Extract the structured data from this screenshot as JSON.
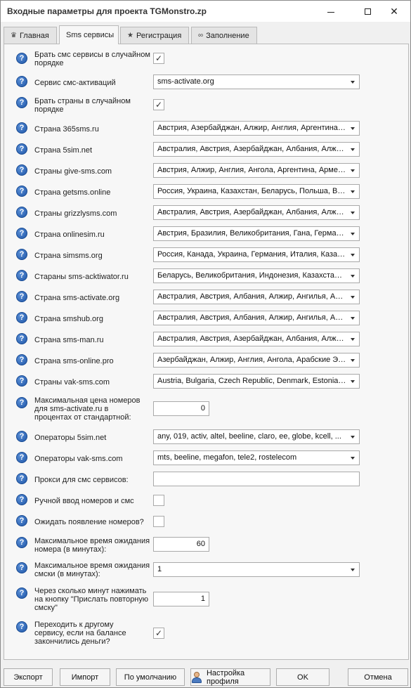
{
  "window": {
    "title": "Входные параметры для проекта TGMonstro.zp",
    "minimize_icon": "minimize-icon",
    "maximize_icon": "maximize-icon",
    "close_icon": "close-icon",
    "close_glyph": "✕"
  },
  "tabs": [
    {
      "label": "Главная",
      "icon": "home-icon",
      "glyph": "♛"
    },
    {
      "label": "Sms сервисы",
      "icon": "",
      "glyph": ""
    },
    {
      "label": "Регистрация",
      "icon": "star-icon",
      "glyph": "★"
    },
    {
      "label": "Заполнение",
      "icon": "infinity-icon",
      "glyph": "∞"
    }
  ],
  "active_tab": "Sms сервисы",
  "help_glyph": "?",
  "check_glyph": "✓",
  "fields": {
    "random_sms": {
      "label": "Брать смс сервисы в случайном порядке",
      "checked": true
    },
    "sms_service": {
      "label": "Сервис смс-активаций",
      "value": "sms-activate.org"
    },
    "random_countries": {
      "label": "Брать страны в случайном порядке",
      "checked": true
    },
    "c365": {
      "label": "Страна 365sms.ru",
      "value": "Австрия, Азербайджан, Алжир, Англия, Аргентина, ..."
    },
    "c5sim": {
      "label": "Страна 5sim.net",
      "value": "Австралия, Австрия, Азербайджан, Албания, Алжир, ..."
    },
    "cgive": {
      "label": "Страны give-sms.com",
      "value": "Австрия, Алжир, Англия, Ангола, Аргентина, Армения, ..."
    },
    "cgetsms": {
      "label": "Страна getsms.online",
      "value": "Россия, Украина, Казахстан, Беларусь, Польша, Великобритания, ..."
    },
    "cgrizzly": {
      "label": "Страны grizzlysms.com",
      "value": "Австралия, Австрия, Азербайджан, Албания, Алжир, ..."
    },
    "conlinesim": {
      "label": "Страна onlinesim.ru",
      "value": "Австрия, Бразилия, Великобритания, Гана, Германия, ..."
    },
    "csimsms": {
      "label": "Страна simsms.org",
      "value": "Россия, Канада, Украина, Германия, Италия, Казахстан, ..."
    },
    "cakt": {
      "label": "Стараны sms-acktiwator.ru",
      "value": "Беларусь, Великобритания, Индонезия, Казахстан, ..."
    },
    "cactivate": {
      "label": "Страна sms-activate.org",
      "value": "Австралия, Австрия, Албания, Алжир, Ангилья, Ангола, ..."
    },
    "csmshub": {
      "label": "Страна smshub.org",
      "value": "Австралия, Австрия, Албания, Алжир, Ангилья, Ангола, ..."
    },
    "csmsman": {
      "label": "Страна sms-man.ru",
      "value": "Австралия, Австрия, Азербайджан, Албания, Алжир, ..."
    },
    "csmsonline": {
      "label": "Страна sms-online.pro",
      "value": "Азербайджан, Алжир, Англия, Ангола, Арабские Эмираты, ..."
    },
    "cvak": {
      "label": "Страны vak-sms.com",
      "value": "Austria, Bulgaria, Czech Republic, Denmark, Estonia, ..."
    },
    "max_price": {
      "label": "Максимальная цена номеров для sms-activate.ru в процентах от стандартной:",
      "value": "0"
    },
    "op5sim": {
      "label": "Операторы 5sim.net",
      "value": "any, 019, activ, altel, beeline, claro, ee, globe, kcell, ..."
    },
    "opvak": {
      "label": "Операторы vak-sms.com",
      "value": "mts, beeline, megafon, tele2, rostelecom"
    },
    "proxy": {
      "label": "Прокси для смс сервисов:",
      "value": ""
    },
    "manual": {
      "label": "Ручной ввод номеров и смс",
      "checked": false
    },
    "wait_numbers": {
      "label": "Ожидать появление номеров?",
      "checked": false
    },
    "wait_number_time": {
      "label": "Максимальное время ожидания номера (в минутах):",
      "value": "60"
    },
    "wait_sms_time": {
      "label": "Максимальное время ожидания смски (в минутах):",
      "value": "1"
    },
    "resend": {
      "label": "Через сколько минут нажимать на кнопку \"Прислать повторную смску\"",
      "value": "1"
    },
    "switch_service": {
      "label": "Переходить к другому сервису, если на балансе закончились деньги?",
      "checked": true
    }
  },
  "footer": {
    "export": "Экспорт",
    "import": "Импорт",
    "defaults": "По умолчанию",
    "profile": "Настройка профиля",
    "profile_icon": "user-profile-icon",
    "ok": "OK",
    "cancel": "Отмена"
  }
}
